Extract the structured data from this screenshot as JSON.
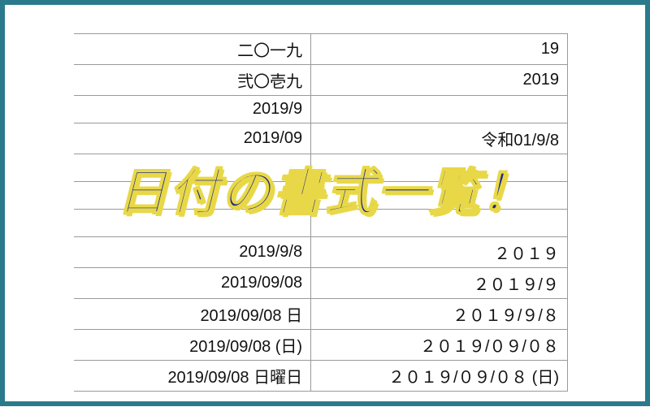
{
  "title": "日付の書式一覧！",
  "rows": [
    {
      "left": "二〇一九",
      "right": "19"
    },
    {
      "left": "弐〇壱九",
      "right": "2019"
    },
    {
      "left": "2019/9",
      "right": ""
    },
    {
      "left": "2019/09",
      "right": "令和01/9/8"
    },
    {
      "left": "",
      "right": ""
    },
    {
      "left": "",
      "right": ""
    },
    {
      "left": "",
      "right": ""
    },
    {
      "left": "2019/9/8",
      "right": "２０１９"
    },
    {
      "left": "2019/09/08",
      "right": "２０１９/９"
    },
    {
      "left": "2019/09/08 日",
      "right": "２０１９/９/８"
    },
    {
      "left": "2019/09/08 (日)",
      "right": "２０１９/０９/０８"
    },
    {
      "left": "2019/09/08 日曜日",
      "right": "２０１９/０９/０８ (日)"
    }
  ]
}
